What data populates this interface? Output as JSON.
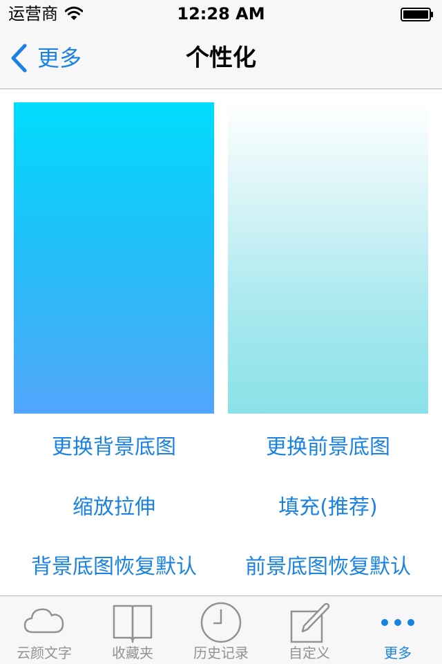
{
  "status_bar": {
    "carrier": "运营商",
    "time": "12:28 AM"
  },
  "nav": {
    "back_label": "更多",
    "title": "个性化"
  },
  "options": {
    "change_background": "更换背景底图",
    "change_foreground": "更换前景底图",
    "scale_stretch": "缩放拉伸",
    "fill_recommended": "填充(推荐)",
    "reset_background": "背景底图恢复默认",
    "reset_foreground": "前景底图恢复默认"
  },
  "tabs": [
    {
      "label": "云颜文字",
      "icon": "cloud-icon",
      "active": false
    },
    {
      "label": "收藏夹",
      "icon": "book-icon",
      "active": false
    },
    {
      "label": "历史记录",
      "icon": "clock-icon",
      "active": false
    },
    {
      "label": "自定义",
      "icon": "edit-icon",
      "active": false
    },
    {
      "label": "更多",
      "icon": "more-icon",
      "active": true
    }
  ],
  "colors": {
    "accent": "#1a82e2",
    "tab_inactive": "#929292",
    "bar_background": "#f7f7f7"
  }
}
